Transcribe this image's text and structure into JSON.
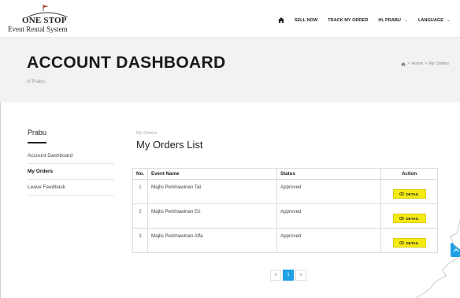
{
  "logo": {
    "line1": "ONE STOP",
    "line2": "Event Rental System"
  },
  "nav": {
    "home_icon": "home-icon",
    "sell_now": "SELL NOW",
    "track_order": "TRACK MY ORDER",
    "user": "HI, PRABU",
    "language": "LANGUAGE",
    "chevron": "⌄"
  },
  "banner": {
    "title": "ACCOUNT DASHBOARD",
    "subtitle": "of Prabu.",
    "breadcrumb": {
      "home": "Home",
      "sep": ">",
      "current": "My Orders"
    }
  },
  "sidebar": {
    "name": "Prabu",
    "items": [
      {
        "label": "Account Dashboard",
        "active": false
      },
      {
        "label": "My Orders",
        "active": true
      },
      {
        "label": "Leave Feedback",
        "active": false
      }
    ]
  },
  "main": {
    "crumb": "My Orders",
    "heading": "My Orders List",
    "columns": [
      "No.",
      "Event Name",
      "Status",
      "Action"
    ],
    "rows": [
      {
        "no": "1",
        "event": "Majlis Perkhawinan Tat",
        "status": "Approved",
        "action": "DETAIL"
      },
      {
        "no": "2",
        "event": "Majlis Perkhawinan Eri",
        "status": "Approved",
        "action": "DETAIL"
      },
      {
        "no": "3",
        "event": "Majlis Perkhawinan Affa",
        "status": "Approved",
        "action": "DETAIL"
      }
    ]
  },
  "pagination": {
    "prev": "«",
    "current": "1",
    "next": "»"
  },
  "colors": {
    "accent": "#1ea0e6",
    "button_yellow": "#f6ea14",
    "banner_bg": "#f2f2f2"
  }
}
